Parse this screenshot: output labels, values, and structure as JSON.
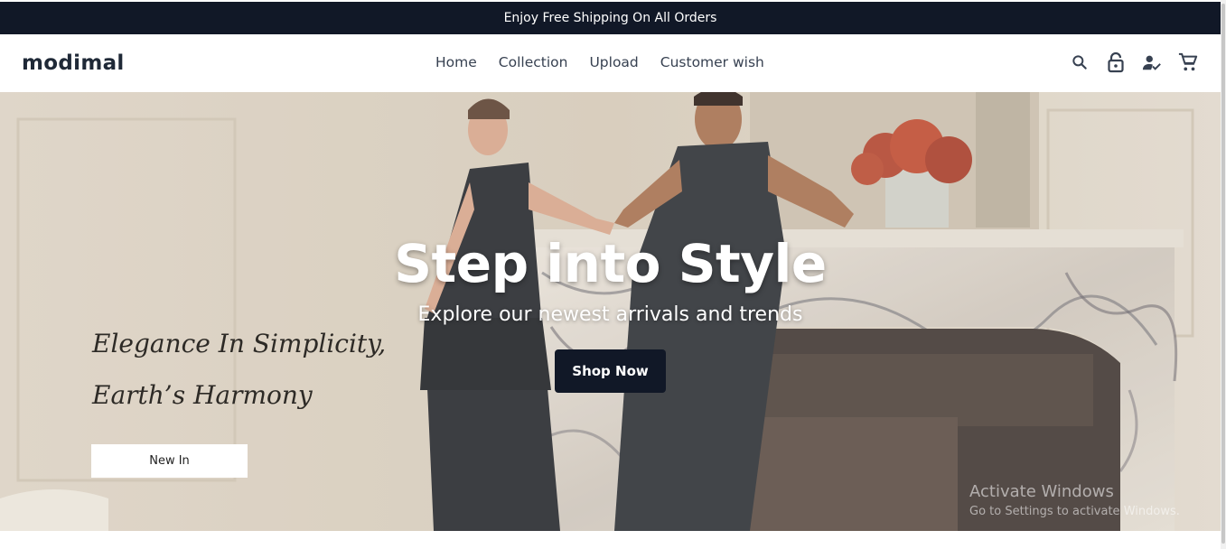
{
  "announcement": {
    "text": "Enjoy Free Shipping On All Orders"
  },
  "header": {
    "logo": "modimal",
    "nav": [
      {
        "label": "Home"
      },
      {
        "label": "Collection"
      },
      {
        "label": "Upload"
      },
      {
        "label": "Customer wish"
      }
    ],
    "icons": [
      "search-icon",
      "lock-icon",
      "user-check-icon",
      "cart-icon"
    ]
  },
  "hero": {
    "title": "Step into Style",
    "subtitle": "Explore our newest arrivals and trends",
    "cta_label": "Shop Now",
    "tagline_line1": "Elegance In Simplicity,",
    "tagline_line2": "Earth’s Harmony",
    "new_in_label": "New In"
  },
  "watermark": {
    "line1": "Activate Windows",
    "line2": "Go to Settings to activate Windows."
  },
  "colors": {
    "primary_dark": "#111827",
    "nav_text": "#374151",
    "hero_bg": "#d9cfc0"
  }
}
